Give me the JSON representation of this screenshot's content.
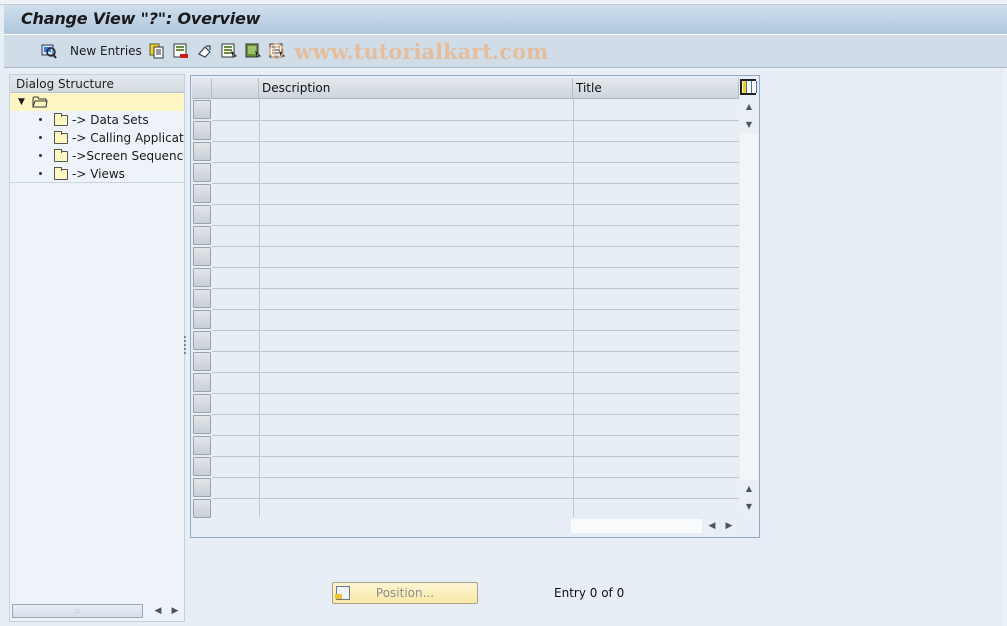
{
  "window": {
    "title": "Change View \"?\": Overview"
  },
  "toolbar": {
    "items": [
      {
        "icon": "display-change-icon",
        "label": ""
      },
      {
        "icon": "new-entries",
        "label": "New Entries"
      },
      {
        "icon": "copy-icon",
        "label": ""
      },
      {
        "icon": "delete-icon",
        "label": ""
      },
      {
        "icon": "undo-change-icon",
        "label": ""
      },
      {
        "icon": "select-all-icon",
        "label": ""
      },
      {
        "icon": "select-block-icon",
        "label": ""
      },
      {
        "icon": "deselect-all-icon",
        "label": ""
      }
    ],
    "new_entries_label": "New Entries",
    "watermark": "© www.tutorialkart.com"
  },
  "dialog_structure": {
    "header": "Dialog Structure",
    "root_label": "",
    "items": [
      {
        "label": "-> Data Sets"
      },
      {
        "label": "-> Calling Application"
      },
      {
        "label": "->Screen Sequences"
      },
      {
        "label": "-> Views"
      }
    ]
  },
  "table": {
    "columns": [
      "",
      "Description",
      "Title"
    ],
    "rows": [
      [
        "",
        "",
        ""
      ],
      [
        "",
        "",
        ""
      ],
      [
        "",
        "",
        ""
      ],
      [
        "",
        "",
        ""
      ],
      [
        "",
        "",
        ""
      ],
      [
        "",
        "",
        ""
      ],
      [
        "",
        "",
        ""
      ],
      [
        "",
        "",
        ""
      ],
      [
        "",
        "",
        ""
      ],
      [
        "",
        "",
        ""
      ],
      [
        "",
        "",
        ""
      ],
      [
        "",
        "",
        ""
      ],
      [
        "",
        "",
        ""
      ],
      [
        "",
        "",
        ""
      ],
      [
        "",
        "",
        ""
      ],
      [
        "",
        "",
        ""
      ],
      [
        "",
        "",
        ""
      ],
      [
        "",
        "",
        ""
      ],
      [
        "",
        "",
        ""
      ],
      [
        "",
        "",
        ""
      ]
    ],
    "visible_row_count": 20
  },
  "footer": {
    "position_button": "Position...",
    "entry_status": "Entry 0 of 0"
  },
  "colors": {
    "title_bar": "#afc6dc",
    "toolbar": "#d0dde8",
    "tree_root_highlight": "#fdf6c4",
    "background": "#e8eef6",
    "position_button": "#f9e9a6"
  }
}
